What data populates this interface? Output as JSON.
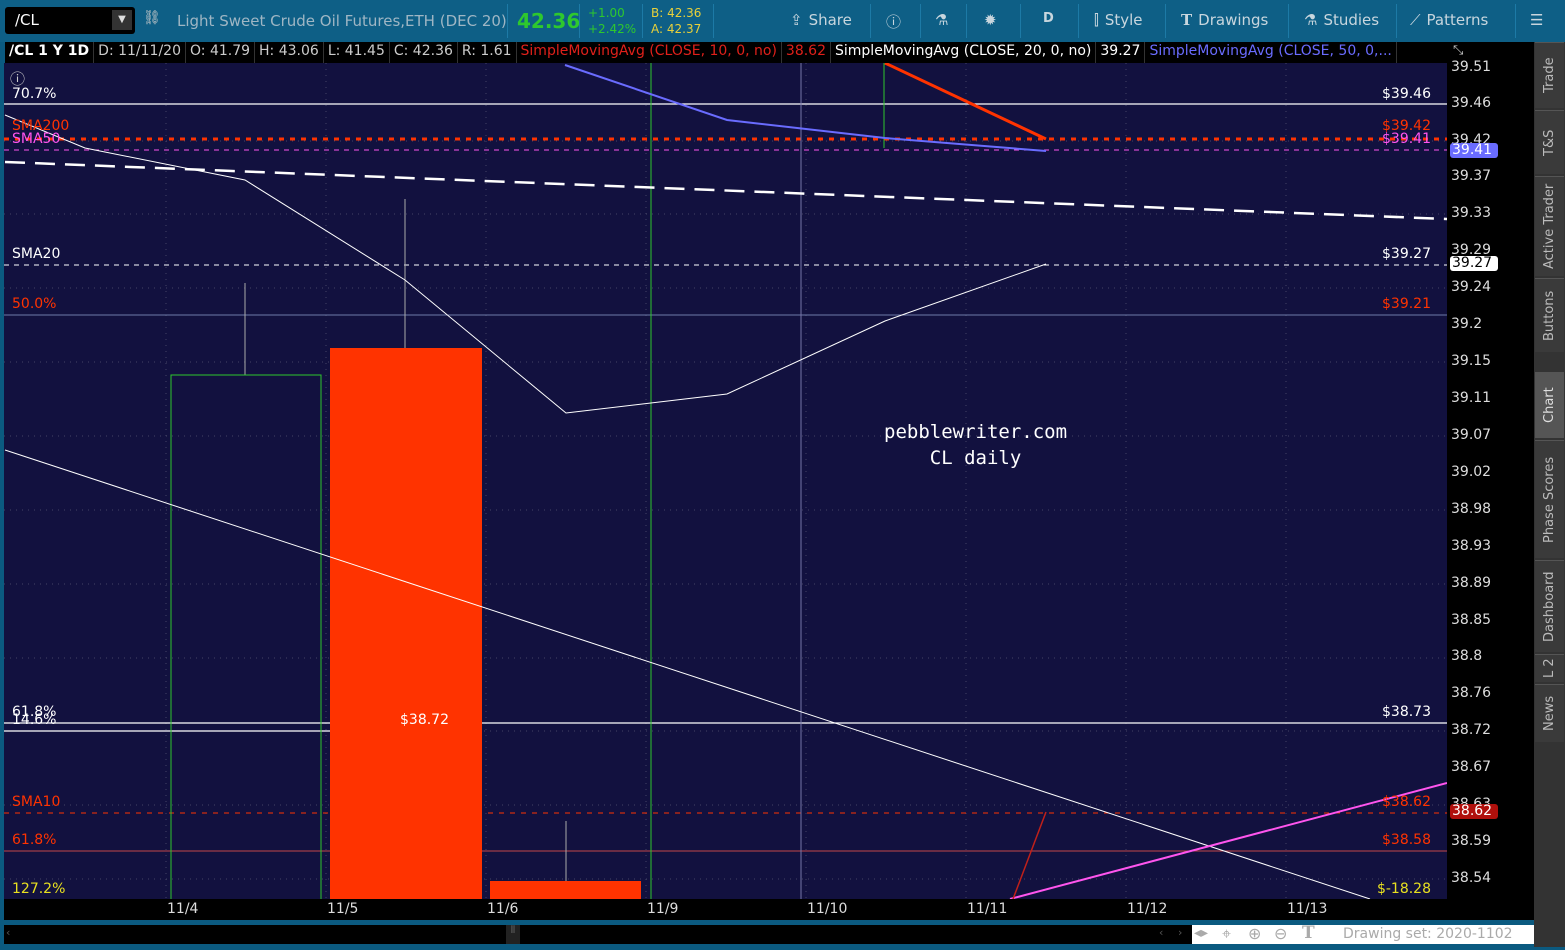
{
  "topbar": {
    "symbol": "/CL",
    "description": "Light Sweet Crude Oil Futures,ETH (DEC 20)",
    "last": "42.36",
    "change": "+1.00",
    "change_pct": "+2.42%",
    "bid": "B: 42.36",
    "ask": "A: 42.37",
    "share": "Share",
    "period": "D",
    "style": "Style",
    "drawings": "Drawings",
    "studies": "Studies",
    "patterns": "Patterns"
  },
  "infobar": {
    "sym": "/CL 1 Y 1D",
    "date": "D: 11/11/20",
    "open": "O: 41.79",
    "high": "H: 43.06",
    "low": "L: 41.45",
    "close": "C: 42.36",
    "range": "R: 1.61",
    "sma10": "SimpleMovingAvg (CLOSE, 10, 0, no)",
    "sma10_val": "38.62",
    "sma20": "SimpleMovingAvg (CLOSE, 20, 0, no)",
    "sma20_val": "39.27",
    "sma50": "SimpleMovingAvg (CLOSE, 50, 0,..."
  },
  "price_axis": [
    "39.51",
    "39.46",
    "39.42",
    "39.37",
    "39.33",
    "39.29",
    "39.24",
    "39.2",
    "39.15",
    "39.11",
    "39.07",
    "39.02",
    "38.98",
    "38.93",
    "38.89",
    "38.85",
    "38.8",
    "38.76",
    "38.72",
    "38.67",
    "38.63",
    "38.59",
    "38.54"
  ],
  "tags": {
    "sma50": "39.41",
    "sma20": "39.27",
    "sma10": "38.62"
  },
  "x_axis": [
    "11/4",
    "11/5",
    "11/6",
    "11/9",
    "11/10",
    "11/11",
    "11/12",
    "11/13"
  ],
  "levels": {
    "fib707": "70.7%",
    "fib707_val": "$39.46",
    "sma200": "SMA200",
    "sma200_val": "$39.42",
    "sma50": "SMA50",
    "sma50_val": "$39.41",
    "sma20": "SMA20",
    "sma20_val": "$39.27",
    "fib50": "50.0%",
    "fib50_val": "$39.21",
    "fib618w": "61.8%",
    "fib146": "14.6%",
    "fib618w_val": "$38.73",
    "mid_val": "$38.72",
    "sma10": "SMA10",
    "sma10_val": "$38.62",
    "fib618r": "61.8%",
    "fib618r_val": "$38.58",
    "fib1272": "127.2%",
    "fib1272_val": "$-18.28"
  },
  "watermark": [
    "pebblewriter.com",
    "CL daily"
  ],
  "side_tabs": [
    "Trade",
    "T&S",
    "Active Trader",
    "Buttons",
    "Chart",
    "Phase Scores",
    "Dashboard",
    "L 2",
    "News"
  ],
  "footer": {
    "drawing_set": "Drawing set: 2020-1102"
  },
  "colors": {
    "bg": "#12113f",
    "up": "#2ec82e",
    "down": "#ff3300",
    "sma50": "#6a6cff",
    "magenta": "#ff55ee"
  }
}
